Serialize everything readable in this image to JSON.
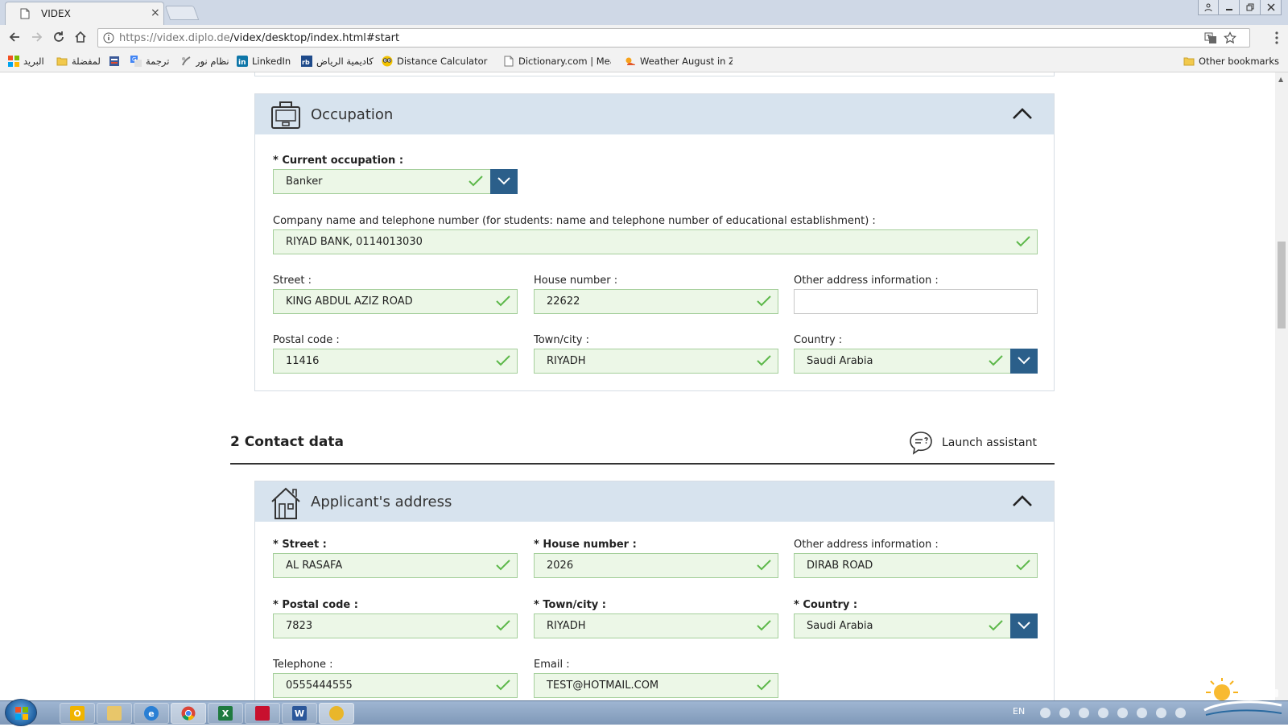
{
  "browser": {
    "tab_title": "VIDEX",
    "tab_close": "×",
    "url_host": "https://videx.diplo.de",
    "url_path": "/videx/desktop/index.html#start",
    "bookmarks": [
      {
        "label": "البريد",
        "color": "#e04a2f"
      },
      {
        "label": "المفضلة",
        "color": "#f2c94c"
      },
      {
        "label": "",
        "color": "#3b5998"
      },
      {
        "label": "ترجمة",
        "color": "#4285f4"
      },
      {
        "label": "نظام نور",
        "color": "#7a7a7a"
      },
      {
        "label": "LinkedIn",
        "color": "#0e76a8"
      },
      {
        "label": "أكاديمية الرياض",
        "color": "#1e4a8a"
      },
      {
        "label": "Distance Calculator b",
        "color": "#f2c200"
      },
      {
        "label": "Dictionary.com | Mea",
        "color": "#9a9a9a"
      },
      {
        "label": "Weather August in Z",
        "color": "#e2572a"
      }
    ],
    "other_bookmarks": "Other bookmarks"
  },
  "occupation": {
    "title": "Occupation",
    "current_occupation_label": "* Current occupation :",
    "current_occupation_value": "Banker",
    "company_label": "Company name and telephone number (for students: name and telephone number of educational establishment) :",
    "company_value": "RIYAD BANK, 0114013030",
    "street_label": "Street :",
    "street_value": "KING ABDUL AZIZ ROAD",
    "house_label": "House number :",
    "house_value": "22622",
    "other_label": "Other address information :",
    "other_value": "",
    "postal_label": "Postal code :",
    "postal_value": "11416",
    "town_label": "Town/city :",
    "town_value": "RIYADH",
    "country_label": "Country :",
    "country_value": "Saudi Arabia"
  },
  "contact": {
    "section_title": "2 Contact data",
    "assistant_label": "Launch assistant",
    "address_title": "Applicant's address",
    "street_label": "* Street :",
    "street_value": "AL RASAFA",
    "house_label": "* House number :",
    "house_value": "2026",
    "other_label": "Other address information :",
    "other_value": "DIRAB ROAD",
    "postal_label": "* Postal code :",
    "postal_value": "7823",
    "town_label": "* Town/city :",
    "town_value": "RIYADH",
    "country_label": "* Country :",
    "country_value": "Saudi Arabia",
    "phone_label": "Telephone :",
    "phone_value": "0555444555",
    "email_label": "Email :",
    "email_value": "TEST@HOTMAIL.COM"
  },
  "taskbar": {
    "language": "EN",
    "apps": [
      {
        "name": "outlook",
        "glyph": "O",
        "color": "#f0b400"
      },
      {
        "name": "explorer",
        "glyph": "",
        "color": "#e8c66a"
      },
      {
        "name": "internet-explorer",
        "glyph": "e",
        "color": "#2a7fd4"
      },
      {
        "name": "chrome",
        "glyph": "",
        "color": "#db4437"
      },
      {
        "name": "excel",
        "glyph": "X",
        "color": "#1f7a3f"
      },
      {
        "name": "acrobat",
        "glyph": "",
        "color": "#c8102e"
      },
      {
        "name": "word",
        "glyph": "W",
        "color": "#2b579a"
      },
      {
        "name": "search",
        "glyph": "",
        "color": "#e9b62a"
      }
    ]
  },
  "colors": {
    "valid_field_bg": "#ecf7e7",
    "valid_field_border": "#a5cf9b",
    "check": "#5db84a",
    "select_button": "#2b5f8a",
    "panel_header": "#d7e3ee"
  }
}
